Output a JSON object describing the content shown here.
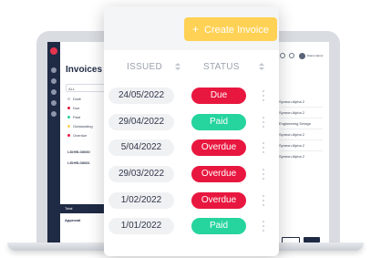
{
  "colors": {
    "due": "#e8173f",
    "paid": "#26d49d",
    "overdue": "#e8173f",
    "create": "#ffd155"
  },
  "background_app": {
    "title": "Invoices",
    "filter_value": "ALL",
    "filters": [
      {
        "label": "Draft",
        "color": "#c9ccd3"
      },
      {
        "label": "Due",
        "color": "#e8173f"
      },
      {
        "label": "Paid",
        "color": "#26d49d"
      },
      {
        "label": "Outstanding",
        "color": "#ffd155"
      },
      {
        "label": "Overdue",
        "color": "#e8173f"
      }
    ],
    "invoice_ids": [
      "I-IDHB-08080",
      "I-IDHB-08081"
    ],
    "foot_label": "Total",
    "approval_label": "Approval",
    "right_panel_items": [
      "Syneon Alpha 2",
      "Syneon Alpha 2",
      "Engineering Design",
      "Syneon Alpha 2",
      "Syneon Alpha 2",
      "Syneon Alpha 2"
    ],
    "user_name": "Diana Hamer"
  },
  "card": {
    "create_label": "Create Invoice",
    "columns": {
      "issued": "ISSUED",
      "status": "STATUS"
    },
    "rows": [
      {
        "date": "24/05/2022",
        "status": "Due",
        "kind": "due"
      },
      {
        "date": "29/04/2022",
        "status": "Paid",
        "kind": "paid"
      },
      {
        "date": "5/04/2022",
        "status": "Overdue",
        "kind": "overdue"
      },
      {
        "date": "29/03/2022",
        "status": "Overdue",
        "kind": "overdue"
      },
      {
        "date": "1/02/2022",
        "status": "Overdue",
        "kind": "overdue"
      },
      {
        "date": "1/01/2022",
        "status": "Paid",
        "kind": "paid"
      }
    ]
  }
}
